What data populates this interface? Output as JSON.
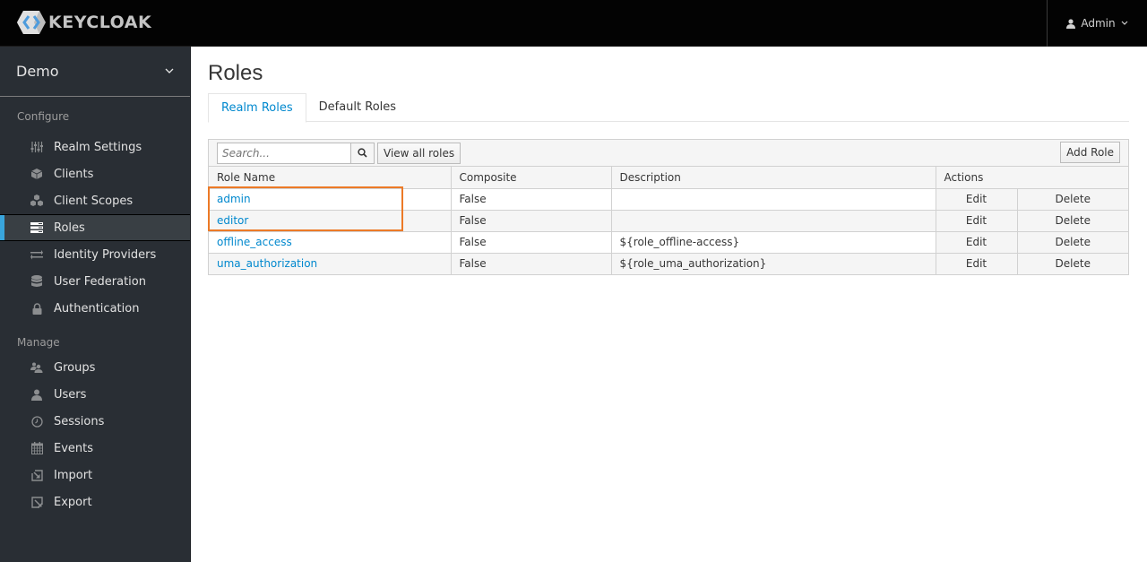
{
  "header": {
    "logo_text": "KEYCLOAK",
    "user_label": "Admin"
  },
  "sidebar": {
    "realm": "Demo",
    "configure_title": "Configure",
    "configure_items": [
      {
        "label": "Realm Settings",
        "icon": "sliders-icon"
      },
      {
        "label": "Clients",
        "icon": "cube-icon"
      },
      {
        "label": "Client Scopes",
        "icon": "cubes-icon"
      },
      {
        "label": "Roles",
        "icon": "roles-icon",
        "active": true
      },
      {
        "label": "Identity Providers",
        "icon": "exchange-icon"
      },
      {
        "label": "User Federation",
        "icon": "database-icon"
      },
      {
        "label": "Authentication",
        "icon": "lock-icon"
      }
    ],
    "manage_title": "Manage",
    "manage_items": [
      {
        "label": "Groups",
        "icon": "users-icon"
      },
      {
        "label": "Users",
        "icon": "user-icon"
      },
      {
        "label": "Sessions",
        "icon": "clock-icon"
      },
      {
        "label": "Events",
        "icon": "calendar-icon"
      },
      {
        "label": "Import",
        "icon": "import-icon"
      },
      {
        "label": "Export",
        "icon": "export-icon"
      }
    ]
  },
  "main": {
    "title": "Roles",
    "tabs": [
      {
        "label": "Realm Roles",
        "active": true
      },
      {
        "label": "Default Roles"
      }
    ],
    "toolbar": {
      "search_placeholder": "Search...",
      "view_all_label": "View all roles",
      "add_role_label": "Add Role"
    },
    "table": {
      "headers": [
        "Role Name",
        "Composite",
        "Description",
        "Actions"
      ],
      "rows": [
        {
          "name": "admin",
          "composite": "False",
          "description": "",
          "edit": "Edit",
          "delete": "Delete"
        },
        {
          "name": "editor",
          "composite": "False",
          "description": "",
          "edit": "Edit",
          "delete": "Delete"
        },
        {
          "name": "offline_access",
          "composite": "False",
          "description": "${role_offline-access}",
          "edit": "Edit",
          "delete": "Delete"
        },
        {
          "name": "uma_authorization",
          "composite": "False",
          "description": "${role_uma_authorization}",
          "edit": "Edit",
          "delete": "Delete"
        }
      ]
    }
  },
  "colors": {
    "accent": "#0088ce",
    "sidebar_bg": "#292e34",
    "active_indicator": "#39a5dc",
    "highlight": "#ec7a27"
  }
}
